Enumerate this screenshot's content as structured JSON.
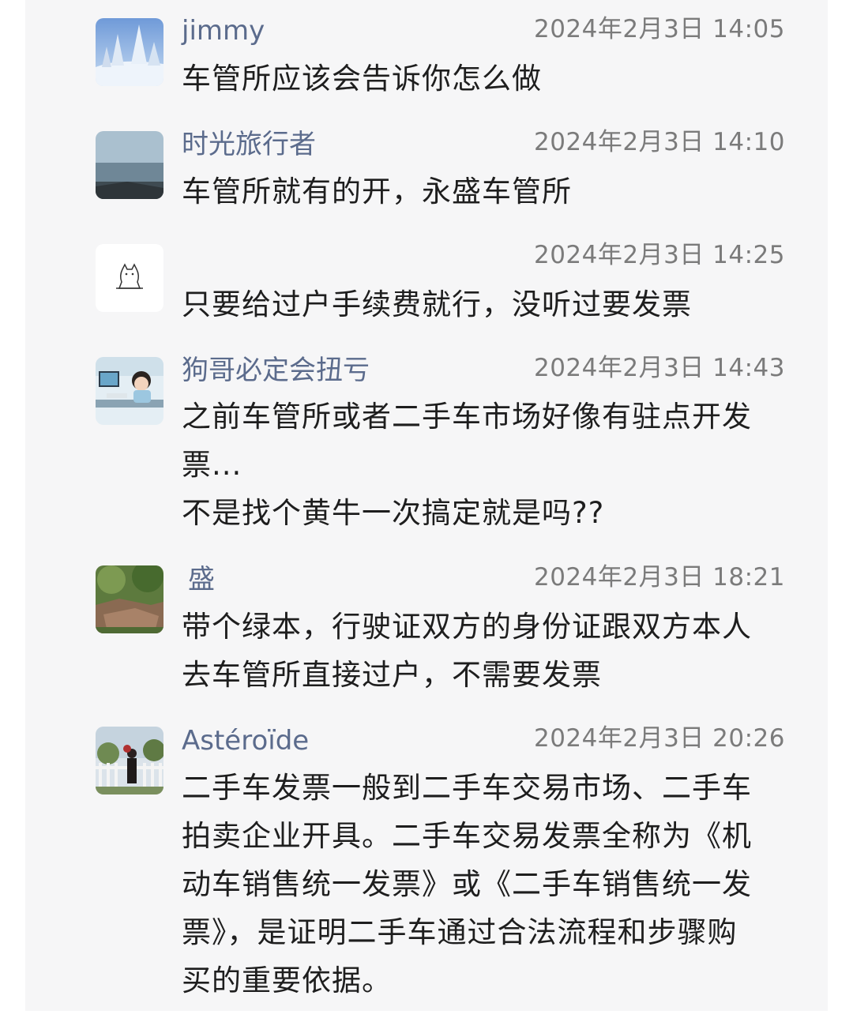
{
  "comments": [
    {
      "name": "jimmy",
      "time": "2024年2月3日 14:05",
      "text": "车管所应该会告诉你怎么做",
      "avatar": "snowy-trees-avatar"
    },
    {
      "name": "时光旅行者",
      "time": "2024年2月3日 14:10",
      "text": "车管所就有的开，永盛车管所",
      "avatar": "seascape-avatar"
    },
    {
      "name": "",
      "time": "2024年2月3日 14:25",
      "text": "只要给过户手续费就行，没听过要发票",
      "avatar": "cat-sketch-avatar"
    },
    {
      "name": "狗哥必定会扭亏",
      "time": "2024年2月3日 14:43",
      "text": "之前车管所或者二手车市场好像有驻点开发\n票...\n不是找个黄牛一次搞定就是吗??",
      "avatar": "boy-at-computer-avatar"
    },
    {
      "name": "盛",
      "time": "2024年2月3日 18:21",
      "text": "带个绿本，行驶证双方的身份证跟双方本人\n去车管所直接过户，不需要发票",
      "avatar": "rocks-garden-avatar"
    },
    {
      "name": "Astéroïde",
      "time": "2024年2月3日 20:26",
      "text": "二手车发票一般到二手车交易市场、二手车\n拍卖企业开具。二手车交易发票全称为《机\n动车销售统一发票》或《二手车销售统一发\n票》，是证明二手车通过合法流程和步骤购\n买的重要依据。",
      "avatar": "girl-by-fence-avatar"
    }
  ],
  "colors": {
    "panel_bg": "#f6f6f7",
    "name": "#5b6b8c",
    "time": "#7b7b7b",
    "text": "#1e1e1e"
  }
}
